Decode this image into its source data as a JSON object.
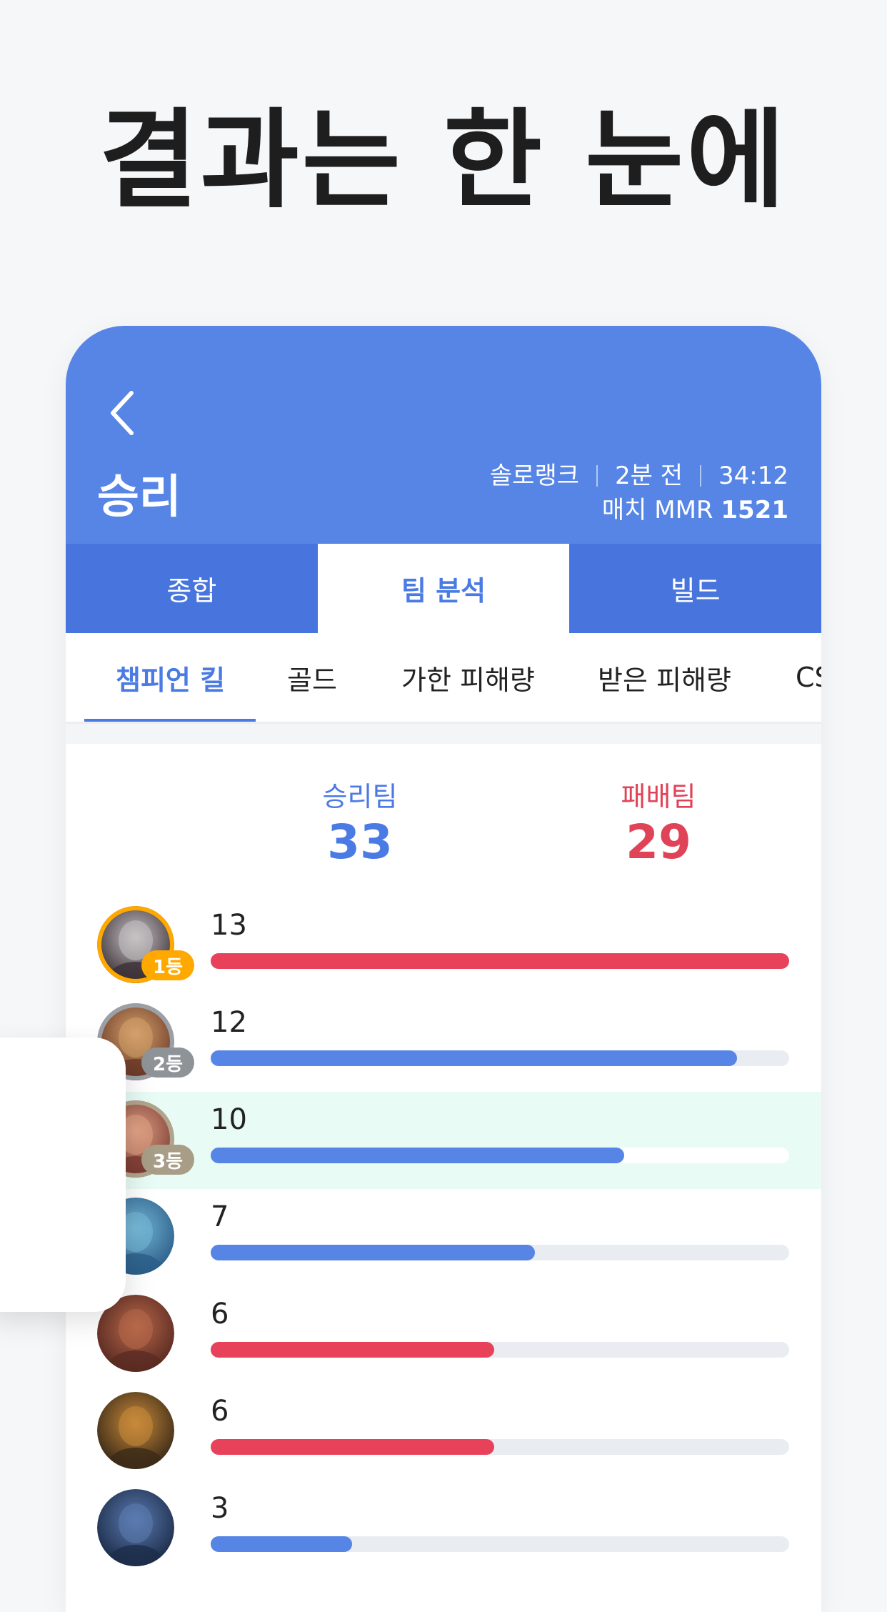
{
  "headline": "결과는 한 눈에",
  "header": {
    "result": "승리",
    "queue": "솔로랭크",
    "time_ago": "2분 전",
    "duration": "34:12",
    "mmr_label": "매치 MMR",
    "mmr_value": "1521"
  },
  "tabs": [
    {
      "label": "종합",
      "active": false
    },
    {
      "label": "팀 분석",
      "active": true
    },
    {
      "label": "빌드",
      "active": false
    }
  ],
  "subtabs": [
    {
      "label": "챔피언 킬",
      "active": true
    },
    {
      "label": "골드",
      "active": false
    },
    {
      "label": "가한 피해량",
      "active": false
    },
    {
      "label": "받은 피해량",
      "active": false
    },
    {
      "label": "CS",
      "active": false
    }
  ],
  "teams": {
    "win_label": "승리팀",
    "win_score": "33",
    "lose_label": "패배팀",
    "lose_score": "29"
  },
  "colors": {
    "header": "#5685e6",
    "tab_bar": "#4775dd",
    "win": "#5685e6",
    "lose": "#e8425b",
    "highlight": "#e8fbf4",
    "rank1": "#ffa800",
    "rank2": "#8e9398",
    "rank3": "#a89d86"
  },
  "players": [
    {
      "kills": "13",
      "fraction": 1.0,
      "team": "lose",
      "rank": "1등",
      "rank_tier": 1,
      "highlight": false,
      "icon": "champion-portrait-icon"
    },
    {
      "kills": "12",
      "fraction": 0.91,
      "team": "win",
      "rank": "2등",
      "rank_tier": 2,
      "highlight": false,
      "icon": "champion-portrait-icon"
    },
    {
      "kills": "10",
      "fraction": 0.715,
      "team": "win",
      "rank": "3등",
      "rank_tier": 3,
      "highlight": true,
      "icon": "champion-portrait-icon"
    },
    {
      "kills": "7",
      "fraction": 0.56,
      "team": "win",
      "rank": "",
      "rank_tier": 0,
      "highlight": false,
      "icon": "champion-portrait-icon"
    },
    {
      "kills": "6",
      "fraction": 0.49,
      "team": "lose",
      "rank": "",
      "rank_tier": 0,
      "highlight": false,
      "icon": "champion-portrait-icon"
    },
    {
      "kills": "6",
      "fraction": 0.49,
      "team": "lose",
      "rank": "",
      "rank_tier": 0,
      "highlight": false,
      "icon": "champion-portrait-icon"
    },
    {
      "kills": "3",
      "fraction": 0.245,
      "team": "win",
      "rank": "",
      "rank_tier": 0,
      "highlight": false,
      "icon": "champion-portrait-icon"
    }
  ]
}
